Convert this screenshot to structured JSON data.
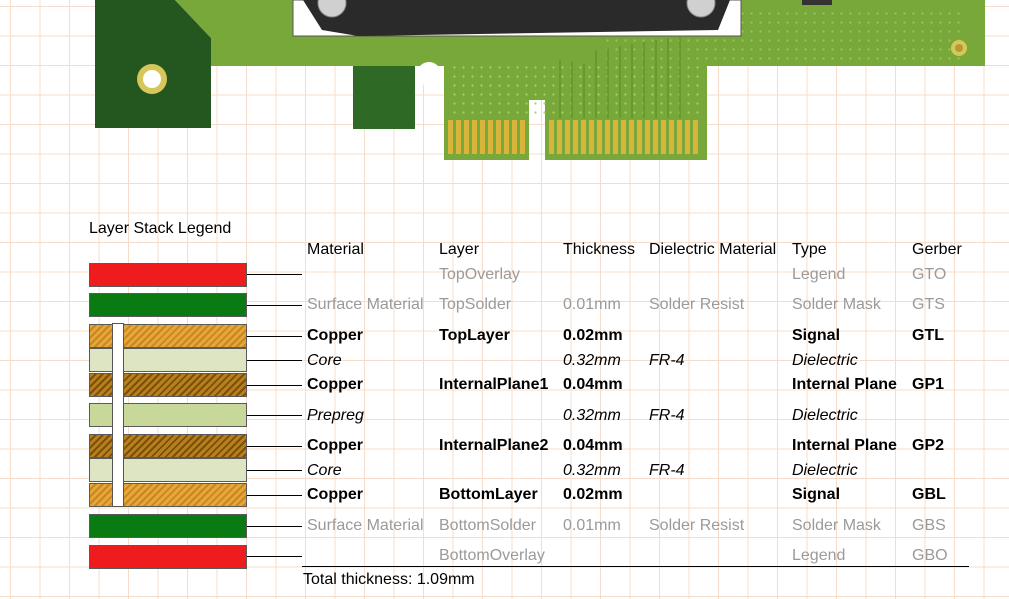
{
  "legend": {
    "title": "Layer Stack Legend"
  },
  "headers": {
    "material": "Material",
    "layer": "Layer",
    "thickness": "Thickness",
    "dielectric": "Dielectric Material",
    "type": "Type",
    "gerber": "Gerber"
  },
  "rows": [
    {
      "material": "",
      "layer": "TopOverlay",
      "thickness": "",
      "dielectric": "",
      "type": "Legend",
      "gerber": "GTO"
    },
    {
      "material": "Surface Material",
      "layer": "TopSolder",
      "thickness": "0.01mm",
      "dielectric": "Solder Resist",
      "type": "Solder Mask",
      "gerber": "GTS"
    },
    {
      "material": "Copper",
      "layer": "TopLayer",
      "thickness": "0.02mm",
      "dielectric": "",
      "type": "Signal",
      "gerber": "GTL"
    },
    {
      "material": "Core",
      "layer": "",
      "thickness": "0.32mm",
      "dielectric": "FR-4",
      "type": "Dielectric",
      "gerber": ""
    },
    {
      "material": "Copper",
      "layer": "InternalPlane1",
      "thickness": "0.04mm",
      "dielectric": "",
      "type": "Internal Plane",
      "gerber": "GP1"
    },
    {
      "material": "Prepreg",
      "layer": "",
      "thickness": "0.32mm",
      "dielectric": "FR-4",
      "type": "Dielectric",
      "gerber": ""
    },
    {
      "material": "Copper",
      "layer": "InternalPlane2",
      "thickness": "0.04mm",
      "dielectric": "",
      "type": "Internal Plane",
      "gerber": "GP2"
    },
    {
      "material": "Core",
      "layer": "",
      "thickness": "0.32mm",
      "dielectric": "FR-4",
      "type": "Dielectric",
      "gerber": ""
    },
    {
      "material": "Copper",
      "layer": "BottomLayer",
      "thickness": "0.02mm",
      "dielectric": "",
      "type": "Signal",
      "gerber": "GBL"
    },
    {
      "material": "Surface Material",
      "layer": "BottomSolder",
      "thickness": "0.01mm",
      "dielectric": "Solder Resist",
      "type": "Solder Mask",
      "gerber": "GBS"
    },
    {
      "material": "",
      "layer": "BottomOverlay",
      "thickness": "",
      "dielectric": "",
      "type": "Legend",
      "gerber": "GBO"
    }
  ],
  "total": "Total thickness: 1.09mm",
  "colors": {
    "overlay": "#ee1c1c",
    "solder_mask": "#0a7a12",
    "copper": "#d89a2c",
    "core": "#dde5c2",
    "prepreg": "#c7d89a",
    "pcb_board": "#78a83a",
    "grid": "#f6dccb"
  }
}
